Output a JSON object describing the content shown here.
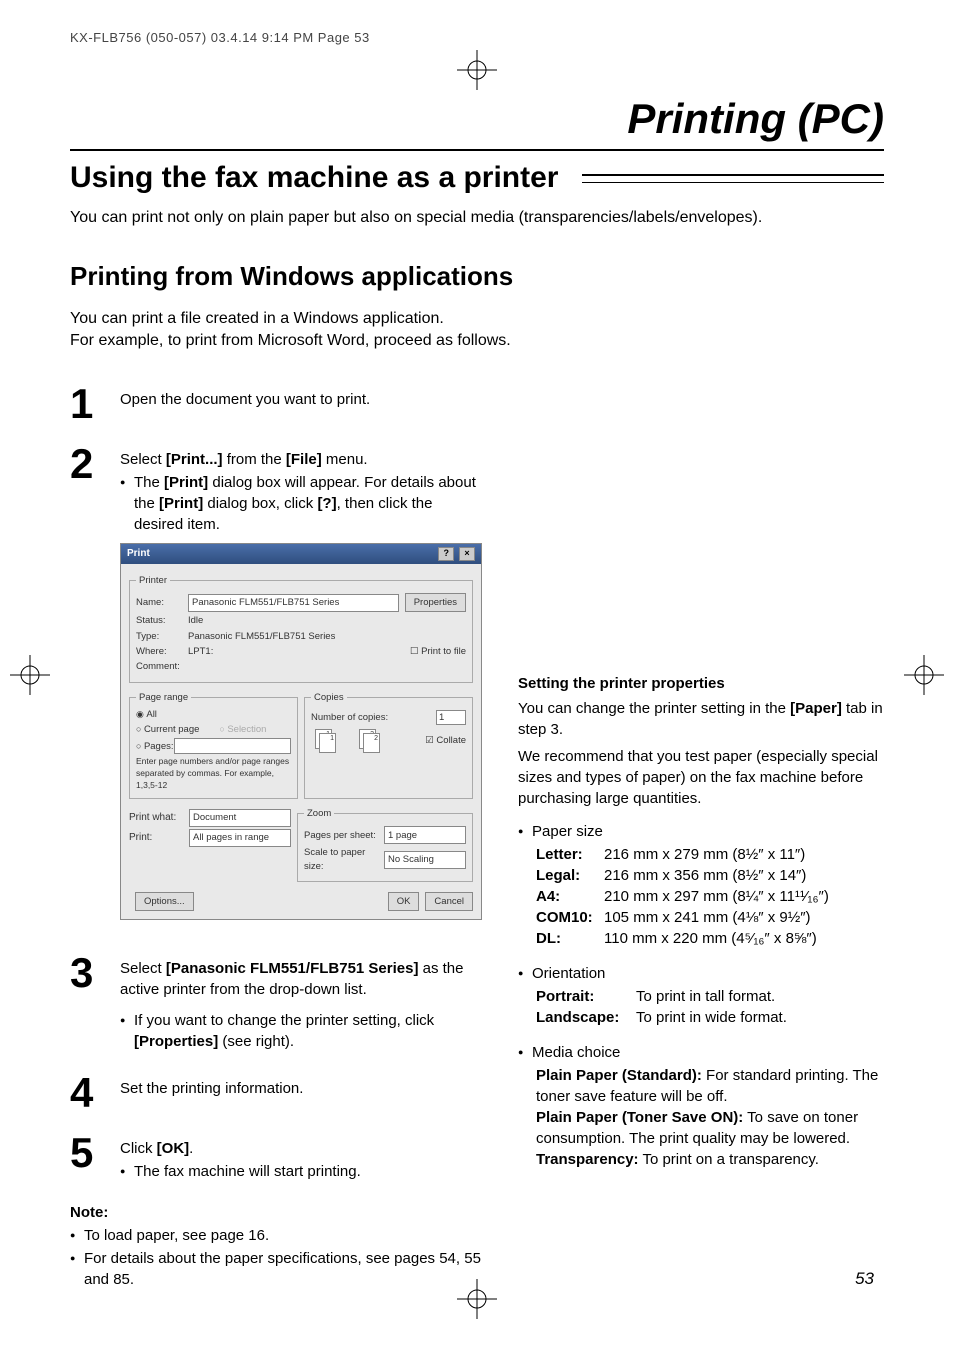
{
  "slug": "KX-FLB756 (050-057)  03.4.14  9:14 PM  Page 53",
  "main_title": "Printing (PC)",
  "section_title": "Using the fax machine as a printer",
  "lead": "You can print not only on plain paper but also on special media (transparencies/labels/envelopes).",
  "subheading": "Printing from Windows applications",
  "subtext_line1": "You can print a file created in a Windows application.",
  "subtext_line2": "For example, to print from Microsoft Word, proceed as follows.",
  "steps": {
    "s1": {
      "num": "1",
      "text": "Open the document you want to print."
    },
    "s2": {
      "num": "2",
      "line1_pre": "Select ",
      "line1_bold": "[Print...]",
      "line1_mid": " from the ",
      "line1_bold2": "[File]",
      "line1_post": " menu.",
      "bullet_a": "The ",
      "bullet_a_bold": "[Print]",
      "bullet_a_post": " dialog box will appear.",
      "bullet_b_pre": "For details about the ",
      "bullet_b_bold": "[Print]",
      "bullet_b_mid": " dialog box, click ",
      "bullet_b_bold2": "[?]",
      "bullet_b_post": ", then click the desired item."
    },
    "s3": {
      "num": "3",
      "line1_pre": "Select ",
      "line1_bold": "[Panasonic FLM551/FLB751 Series]",
      "line1_post": " as the active printer from the drop-down list.",
      "bullet_pre": "If you want to change the printer setting, click ",
      "bullet_bold": "[Properties]",
      "bullet_post": " (see right)."
    },
    "s4": {
      "num": "4",
      "text": "Set the printing information."
    },
    "s5": {
      "num": "5",
      "line1_pre": "Click ",
      "line1_bold": "[OK]",
      "line1_post": ".",
      "bullet": "The fax machine will start printing."
    }
  },
  "note": {
    "title": "Note:",
    "b1": "To load paper, see page 16.",
    "b2": "For details about the paper specifications, see pages 54, 55 and 85."
  },
  "right": {
    "heading": "Setting the printer properties",
    "p1_pre": "You can change the printer setting in the ",
    "p1_bold": "[Paper]",
    "p1_post": " tab in step 3.",
    "p2": "We recommend that you test paper (especially special sizes and types of paper) on the fax machine before purchasing large quantities.",
    "paper_size_label": "Paper size",
    "sizes": {
      "letter_label": "Letter:",
      "letter_val": "216 mm x 279 mm (8½″ x 11″)",
      "legal_label": "Legal:",
      "legal_val": "216 mm x 356 mm (8½″ x 14″)",
      "a4_label": "A4:",
      "a4_val": "210 mm x 297 mm (8¼″ x 11¹¹⁄₁₆″)",
      "com10_label": "COM10:",
      "com10_val": "105 mm x 241 mm (4⅛″ x 9½″)",
      "dl_label": "DL:",
      "dl_val": "110 mm x 220 mm (4⁵⁄₁₆″ x 8⅝″)"
    },
    "orientation_label": "Orientation",
    "orientation": {
      "portrait_label": "Portrait:",
      "portrait_val": "To print in tall format.",
      "landscape_label": "Landscape:",
      "landscape_val": "To print in wide format."
    },
    "media_label": "Media choice",
    "media": {
      "m1_label": "Plain Paper (Standard):",
      "m1_val": " For standard printing. The toner save feature will be off.",
      "m2_label": "Plain Paper (Toner Save ON):",
      "m2_val": " To save on toner consumption. The print quality may be lowered.",
      "m3_label": "Transparency:",
      "m3_val": " To print on a transparency."
    }
  },
  "dialog": {
    "title": "Print",
    "printer_legend": "Printer",
    "name_label": "Name:",
    "name_value": "Panasonic FLM551/FLB751 Series",
    "properties_btn": "Properties",
    "status_label": "Status:",
    "status_value": "Idle",
    "type_label": "Type:",
    "type_value": "Panasonic FLM551/FLB751 Series",
    "where_label": "Where:",
    "where_value": "LPT1:",
    "comment_label": "Comment:",
    "print_to_file": "Print to file",
    "page_range_legend": "Page range",
    "all": "All",
    "current_page": "Current page",
    "selection": "Selection",
    "pages": "Pages:",
    "pages_hint": "Enter page numbers and/or page ranges separated by commas. For example, 1,3,5-12",
    "copies_legend": "Copies",
    "num_copies_label": "Number of copies:",
    "num_copies_value": "1",
    "collate": "Collate",
    "zoom_legend": "Zoom",
    "pages_per_sheet_label": "Pages per sheet:",
    "pages_per_sheet_value": "1 page",
    "scale_label": "Scale to paper size:",
    "scale_value": "No Scaling",
    "print_what_label": "Print what:",
    "print_what_value": "Document",
    "print_label": "Print:",
    "print_value": "All pages in range",
    "options_btn": "Options...",
    "ok_btn": "OK",
    "cancel_btn": "Cancel"
  },
  "page_number": "53",
  "chart_data": null
}
